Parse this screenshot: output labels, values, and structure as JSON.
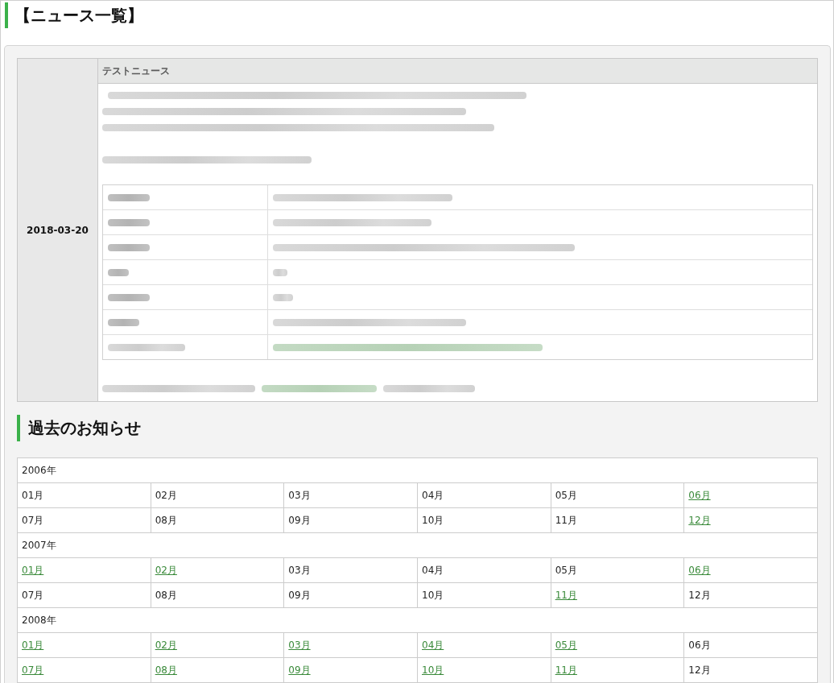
{
  "page_title": "【ニュース一覧】",
  "news": [
    {
      "date": "2018-03-20",
      "title": "テストニュース"
    }
  ],
  "archive": {
    "title": "過去のお知らせ",
    "years": [
      {
        "year": "2006年",
        "months": [
          {
            "label": "01月",
            "linked": false
          },
          {
            "label": "02月",
            "linked": false
          },
          {
            "label": "03月",
            "linked": false
          },
          {
            "label": "04月",
            "linked": false
          },
          {
            "label": "05月",
            "linked": false
          },
          {
            "label": "06月",
            "linked": true
          },
          {
            "label": "07月",
            "linked": false
          },
          {
            "label": "08月",
            "linked": false
          },
          {
            "label": "09月",
            "linked": false
          },
          {
            "label": "10月",
            "linked": false
          },
          {
            "label": "11月",
            "linked": false
          },
          {
            "label": "12月",
            "linked": true
          }
        ]
      },
      {
        "year": "2007年",
        "months": [
          {
            "label": "01月",
            "linked": true
          },
          {
            "label": "02月",
            "linked": true
          },
          {
            "label": "03月",
            "linked": false
          },
          {
            "label": "04月",
            "linked": false
          },
          {
            "label": "05月",
            "linked": false
          },
          {
            "label": "06月",
            "linked": true
          },
          {
            "label": "07月",
            "linked": false
          },
          {
            "label": "08月",
            "linked": false
          },
          {
            "label": "09月",
            "linked": false
          },
          {
            "label": "10月",
            "linked": false
          },
          {
            "label": "11月",
            "linked": true
          },
          {
            "label": "12月",
            "linked": false
          }
        ]
      },
      {
        "year": "2008年",
        "months": [
          {
            "label": "01月",
            "linked": true
          },
          {
            "label": "02月",
            "linked": true
          },
          {
            "label": "03月",
            "linked": true
          },
          {
            "label": "04月",
            "linked": true
          },
          {
            "label": "05月",
            "linked": true
          },
          {
            "label": "06月",
            "linked": false
          },
          {
            "label": "07月",
            "linked": true
          },
          {
            "label": "08月",
            "linked": true
          },
          {
            "label": "09月",
            "linked": true
          },
          {
            "label": "10月",
            "linked": true
          },
          {
            "label": "11月",
            "linked": true
          },
          {
            "label": "12月",
            "linked": false
          }
        ]
      }
    ]
  }
}
